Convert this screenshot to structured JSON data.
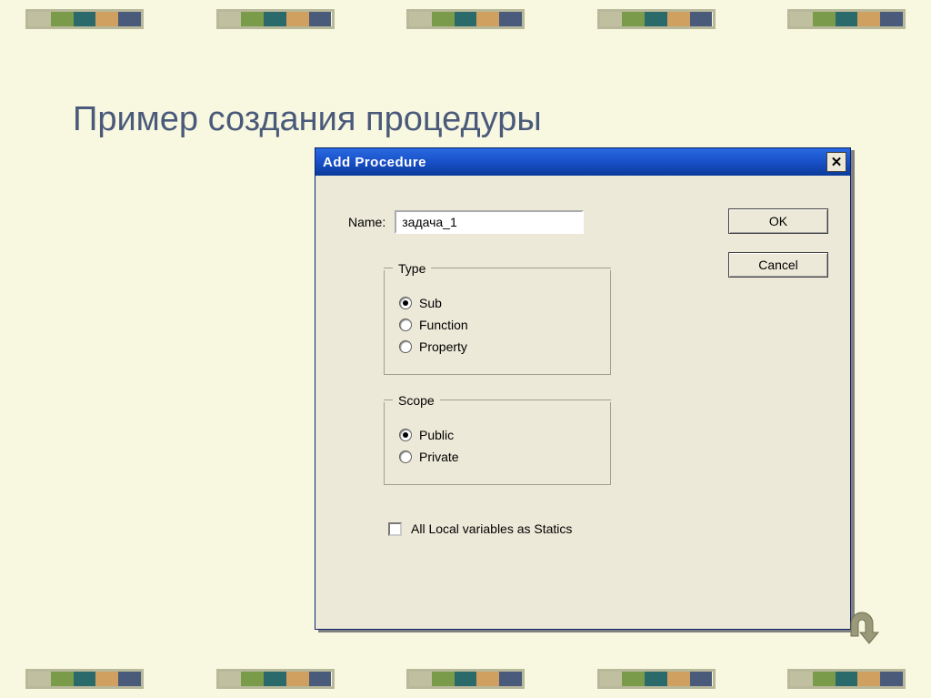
{
  "page": {
    "title": "Пример создания процедуры"
  },
  "dialog": {
    "title": "Add Procedure",
    "name_label": "Name:",
    "name_value": "задача_1",
    "type_group": {
      "legend": "Type",
      "options": {
        "sub": "Sub",
        "function": "Function",
        "property": "Property"
      },
      "selected": "sub"
    },
    "scope_group": {
      "legend": "Scope",
      "options": {
        "public": "Public",
        "private": "Private"
      },
      "selected": "public"
    },
    "checkbox_label": "All Local variables as Statics",
    "buttons": {
      "ok": "OK",
      "cancel": "Cancel"
    }
  }
}
